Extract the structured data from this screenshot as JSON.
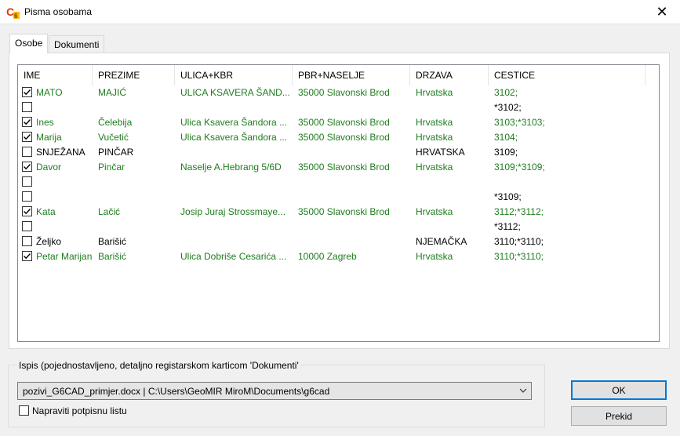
{
  "window": {
    "title": "Pisma osobama",
    "close_glyph": "✕"
  },
  "tabs": [
    {
      "label": "Osobe",
      "active": true
    },
    {
      "label": "Dokumenti",
      "active": false
    }
  ],
  "table": {
    "columns": [
      "IME",
      "PREZIME",
      "ULICA+KBR",
      "PBR+NASELJE",
      "DRZAVA",
      "CESTICE"
    ],
    "rows": [
      {
        "checked": true,
        "green": true,
        "cells": [
          "MATO",
          "MAJIĆ",
          "ULICA KSAVERA ŠAND...",
          "35000 Slavonski Brod",
          "Hrvatska",
          "3102;"
        ]
      },
      {
        "checked": false,
        "green": false,
        "cells": [
          "",
          "",
          "",
          "",
          "",
          "*3102;"
        ]
      },
      {
        "checked": true,
        "green": true,
        "cells": [
          "Ines",
          "Čelebija",
          "Ulica Ksavera Šandora ...",
          "35000 Slavonski Brod",
          "Hrvatska",
          "3103;*3103;"
        ]
      },
      {
        "checked": true,
        "green": true,
        "cells": [
          "Marija",
          "Vučetić",
          "Ulica Ksavera Šandora ...",
          "35000 Slavonski Brod",
          "Hrvatska",
          "3104;"
        ]
      },
      {
        "checked": false,
        "green": false,
        "cells": [
          "SNJEŽANA",
          "PINČAR",
          "",
          "",
          "HRVATSKA",
          "3109;"
        ]
      },
      {
        "checked": true,
        "green": true,
        "cells": [
          "Davor",
          "Pinčar",
          "Naselje A.Hebrang 5/6D",
          "35000 Slavonski Brod",
          "Hrvatska",
          "3109;*3109;"
        ]
      },
      {
        "checked": false,
        "green": false,
        "cells": [
          "",
          "",
          "",
          "",
          "",
          ""
        ]
      },
      {
        "checked": false,
        "green": false,
        "cells": [
          "",
          "",
          "",
          "",
          "",
          "*3109;"
        ]
      },
      {
        "checked": true,
        "green": true,
        "cells": [
          "Kata",
          "Lačić",
          "Josip Juraj Strossmaye...",
          "35000 Slavonski Brod",
          "Hrvatska",
          "3112;*3112;"
        ]
      },
      {
        "checked": false,
        "green": false,
        "cells": [
          "",
          "",
          "",
          "",
          "",
          "*3112;"
        ]
      },
      {
        "checked": false,
        "green": false,
        "cells": [
          "Željko",
          "Barišić",
          "",
          "",
          "NJEMAČKA",
          "3110;*3110;"
        ]
      },
      {
        "checked": true,
        "green": true,
        "cells": [
          "Petar Marijan",
          "Barišić",
          "Ulica Dobriše Cesarića ...",
          "10000 Zagreb",
          "Hrvatska",
          "3110;*3110;"
        ]
      }
    ]
  },
  "output": {
    "group_label": "Ispis (pojednostavljeno, detaljno registarskom karticom 'Dokumenti'",
    "template_value": "pozivi_G6CAD_primjer.docx  |  C:\\Users\\GeoMIR MiroM\\Documents\\g6cad",
    "signature_checkbox_label": "Napraviti potpisnu listu",
    "signature_checked": false
  },
  "buttons": {
    "ok": "OK",
    "cancel": "Prekid"
  },
  "colors": {
    "accent": "#0078d7",
    "checked_row_text": "#1e7d1e"
  },
  "icons": {
    "app": "g6cad-app-icon",
    "close": "close-icon",
    "dropdown": "chevron-down-icon",
    "check": "checkmark-icon"
  }
}
